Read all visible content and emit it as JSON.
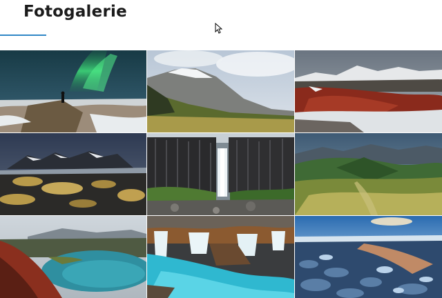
{
  "page": {
    "title": "Fotogalerie"
  },
  "gallery": {
    "photos": [
      {
        "subject": "aurora-borealis"
      },
      {
        "subject": "snowy-mountain-ridge"
      },
      {
        "subject": "red-lava-field"
      },
      {
        "subject": "black-sand-beach-mountains"
      },
      {
        "subject": "basalt-column-waterfall"
      },
      {
        "subject": "green-highland-valley"
      },
      {
        "subject": "crater-lake"
      },
      {
        "subject": "turquoise-cascades"
      },
      {
        "subject": "glacier-lagoon-ice"
      }
    ]
  },
  "colors": {
    "accent": "#2f86c6",
    "title": "#1b1b1b",
    "background": "#ffffff"
  }
}
